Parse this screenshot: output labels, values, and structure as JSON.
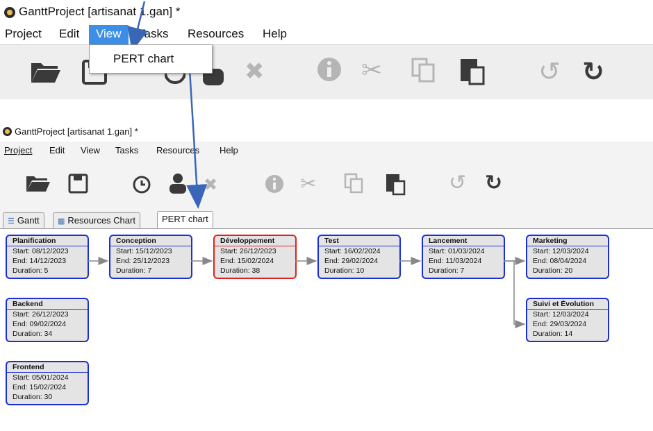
{
  "top_window": {
    "title": "GanttProject [artisanat 1.gan] *",
    "menu": [
      "Project",
      "Edit",
      "View",
      "Tasks",
      "Resources",
      "Help"
    ],
    "selected_menu": "View",
    "dropdown_item": "PERT chart"
  },
  "bottom_window": {
    "title": "GanttProject [artisanat 1.gan] *",
    "menu": [
      "Project",
      "Edit",
      "View",
      "Tasks",
      "Resources",
      "Help"
    ],
    "tabs": [
      "Gantt",
      "Resources Chart",
      "PERT chart"
    ],
    "active_tab": "PERT chart"
  },
  "toolbar_icons": [
    "open-folder-icon",
    "save-icon",
    "clock-icon",
    "person-icon",
    "delete-icon",
    "info-icon",
    "scissors-icon",
    "copy-icon",
    "paste-icon",
    "undo-icon",
    "redo-icon"
  ],
  "colors": {
    "menu_highlight": "#3c8ee6",
    "task_border": "#1c2fd6",
    "critical_border": "#e02020",
    "arrow": "#3a66b8"
  },
  "tasks": [
    {
      "name": "Planification",
      "start": "Start: 08/12/2023",
      "end": "End: 14/12/2023",
      "duration": "Duration: 5"
    },
    {
      "name": "Conception",
      "start": "Start: 15/12/2023",
      "end": "End: 25/12/2023",
      "duration": "Duration: 7"
    },
    {
      "name": "Développement",
      "start": "Start: 26/12/2023",
      "end": "End: 15/02/2024",
      "duration": "Duration: 38"
    },
    {
      "name": "Test",
      "start": "Start: 16/02/2024",
      "end": "End: 29/02/2024",
      "duration": "Duration: 10"
    },
    {
      "name": "Lancement",
      "start": "Start: 01/03/2024",
      "end": "End: 11/03/2024",
      "duration": "Duration: 7"
    },
    {
      "name": "Marketing",
      "start": "Start: 12/03/2024",
      "end": "End: 08/04/2024",
      "duration": "Duration: 20"
    },
    {
      "name": "Backend",
      "start": "Start: 26/12/2023",
      "end": "End: 09/02/2024",
      "duration": "Duration: 34"
    },
    {
      "name": "Suivi et Évolution",
      "start": "Start: 12/03/2024",
      "end": "End: 29/03/2024",
      "duration": "Duration: 14"
    },
    {
      "name": "Frontend",
      "start": "Start: 05/01/2024",
      "end": "End: 15/02/2024",
      "duration": "Duration: 30"
    }
  ]
}
